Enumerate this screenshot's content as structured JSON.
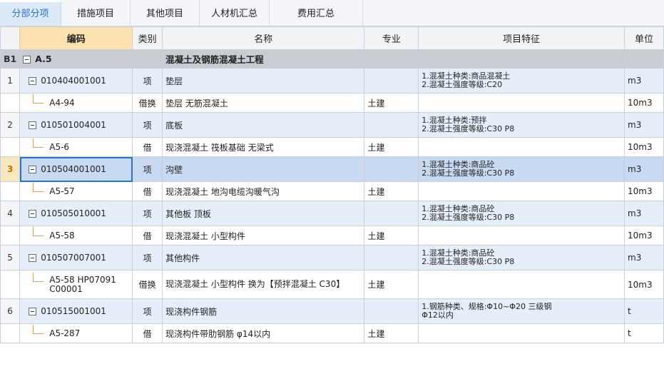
{
  "tabs": [
    {
      "label": "分部分项",
      "active": true
    },
    {
      "label": "措施项目"
    },
    {
      "label": "其他项目"
    },
    {
      "label": "人材机汇总"
    },
    {
      "label": "费用汇总"
    }
  ],
  "columns": [
    "",
    "编码",
    "类别",
    "名称",
    "专业",
    "项目特征",
    "单位"
  ],
  "rows": [
    {
      "num": "B1",
      "code": "A.5",
      "type": "",
      "name": "混凝土及钢筋混凝土工程",
      "major": "",
      "feat1": "",
      "feat2": "",
      "unit": ""
    },
    {
      "num": "1",
      "code": "010404001001",
      "type": "项",
      "name": "垫层",
      "major": "",
      "feat1": "1.混凝土种类:商品混凝土",
      "feat2": "2.混凝土强度等级:C20",
      "unit": "m3"
    },
    {
      "num": "",
      "code": "A4-94",
      "type": "借换",
      "name": "垫层 无筋混凝土",
      "major": "土建",
      "feat1": "",
      "feat2": "",
      "unit": "10m3"
    },
    {
      "num": "2",
      "code": "010501004001",
      "type": "项",
      "name": "底板",
      "major": "",
      "feat1": "1.混凝土种类:预拌",
      "feat2": "2.混凝土强度等级:C30    P8",
      "unit": "m3"
    },
    {
      "num": "",
      "code": "A5-6",
      "type": "借",
      "name": "现浇混凝土 筏板基础 无梁式",
      "major": "土建",
      "feat1": "",
      "feat2": "",
      "unit": "10m3"
    },
    {
      "num": "3",
      "code": "010504001001",
      "type": "项",
      "name": "沟壁",
      "major": "",
      "feat1": "1.混凝土种类:商品砼",
      "feat2": "2.混凝土强度等级:C30    P8",
      "unit": "m3"
    },
    {
      "num": "",
      "code": "A5-57",
      "type": "借",
      "name": "现浇混凝土 地沟电缆沟暖气沟",
      "major": "土建",
      "feat1": "",
      "feat2": "",
      "unit": "10m3"
    },
    {
      "num": "4",
      "code": "010505010001",
      "type": "项",
      "name": "其他板 顶板",
      "major": "",
      "feat1": "1.混凝土种类:商品砼",
      "feat2": "2.混凝土强度等级:C30    P8",
      "unit": "m3"
    },
    {
      "num": "",
      "code": "A5-58",
      "type": "借",
      "name": "现浇混凝土 小型构件",
      "major": "土建",
      "feat1": "",
      "feat2": "",
      "unit": "10m3"
    },
    {
      "num": "5",
      "code": "010507007001",
      "type": "项",
      "name": "其他构件",
      "major": "",
      "feat1": "1.混凝土种类:商品砼",
      "feat2": "2.混凝土强度等级:C30    P8",
      "unit": "m3"
    },
    {
      "num": "",
      "code": "A5-58 HP07091 C00001",
      "type": "借换",
      "name": "现浇混凝土 小型构件  换为【预拌混凝土 C30】",
      "major": "土建",
      "feat1": "",
      "feat2": "",
      "unit": "10m3"
    },
    {
      "num": "6",
      "code": "010515001001",
      "type": "项",
      "name": "现浇构件钢筋",
      "major": "",
      "feat1": "1.钢筋种类、规格:Φ10~Φ20 三级钢",
      "feat2": "Φ12以内",
      "unit": "t"
    },
    {
      "num": "",
      "code": "A5-287",
      "type": "借",
      "name": "现浇构件带肋钢筋 φ14以内",
      "major": "土建",
      "feat1": "",
      "feat2": "",
      "unit": "t"
    }
  ]
}
